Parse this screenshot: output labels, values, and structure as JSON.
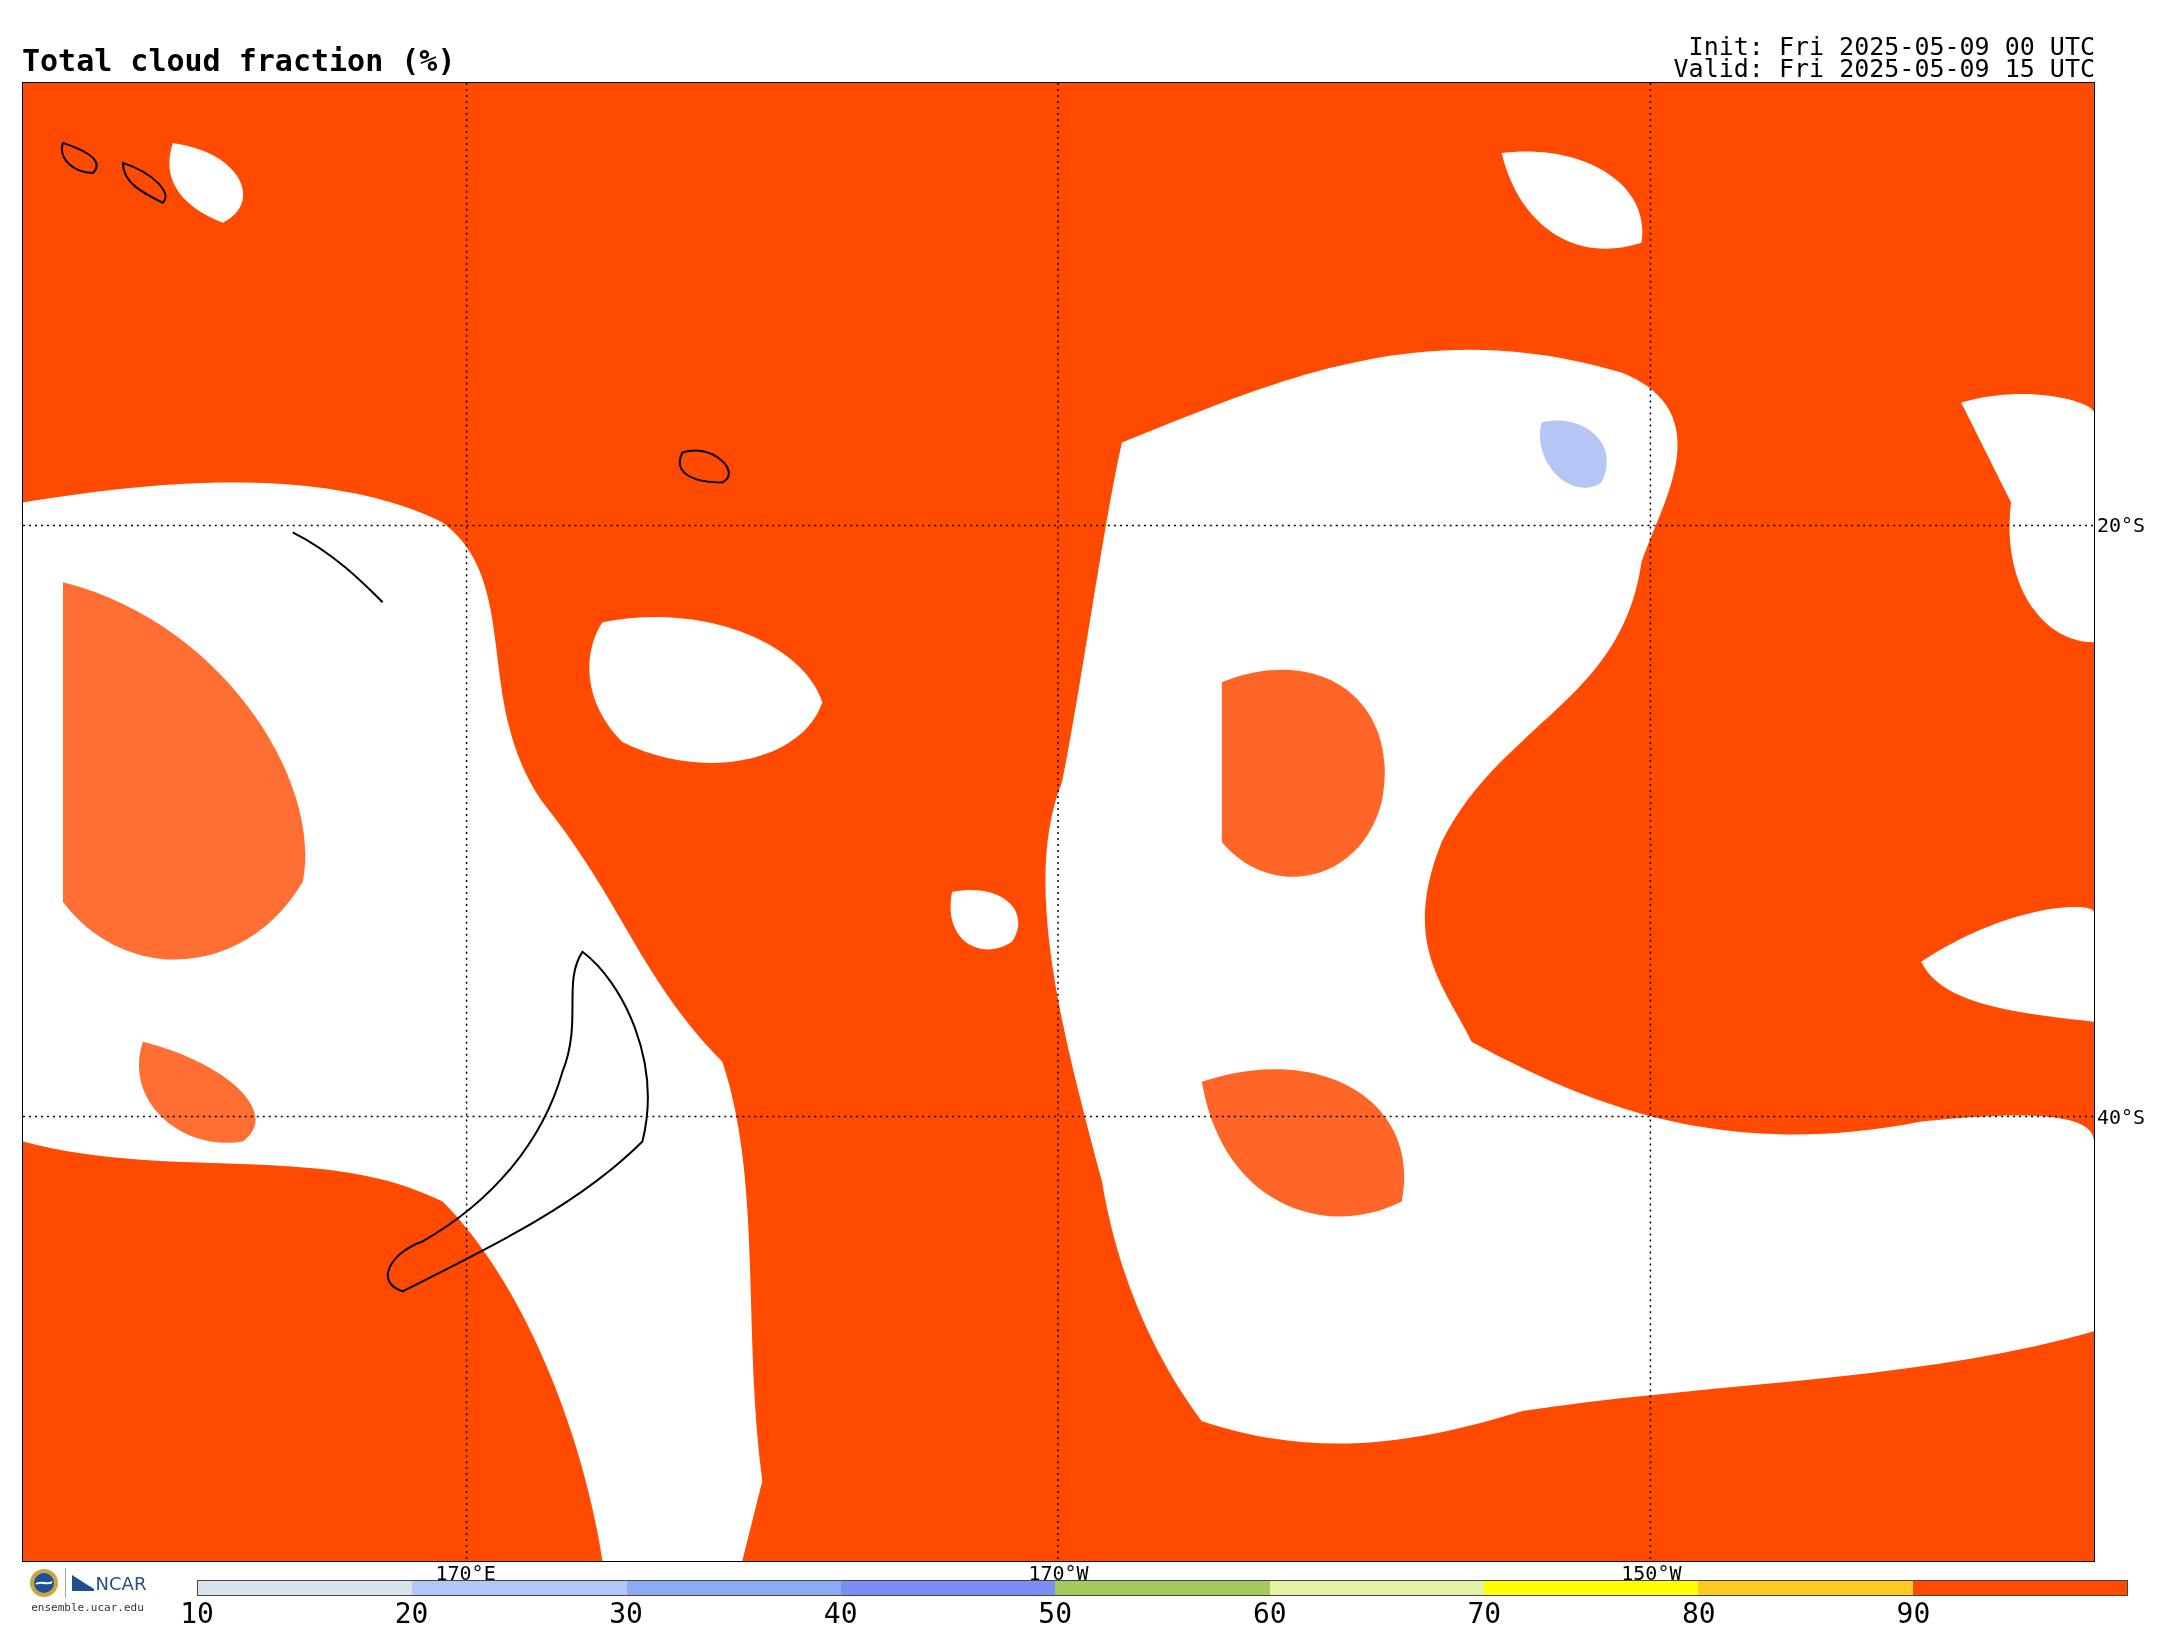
{
  "title": "Total cloud fraction (%)",
  "init": "Init: Fri 2025-05-09 00 UTC",
  "valid": "Valid: Fri 2025-05-09 15 UTC",
  "map": {
    "lat_labels": [
      "20°S",
      "40°S"
    ],
    "lon_labels": [
      "170°E",
      "170°W",
      "150°W"
    ]
  },
  "colorbar": {
    "segments": [
      {
        "color": "#d8e4ec"
      },
      {
        "color": "#b3c6f5"
      },
      {
        "color": "#8eabf8"
      },
      {
        "color": "#7c8ef6"
      },
      {
        "color": "#a5c95c"
      },
      {
        "color": "#e4f4a6"
      },
      {
        "color": "#ffff00"
      },
      {
        "color": "#ffcb22"
      },
      {
        "color": "#ff4a00"
      }
    ],
    "ticks": [
      "10",
      "20",
      "30",
      "40",
      "50",
      "60",
      "70",
      "80",
      "90"
    ]
  },
  "logo": {
    "org": "NCAR",
    "url": "ensemble.ucar.edu"
  }
}
